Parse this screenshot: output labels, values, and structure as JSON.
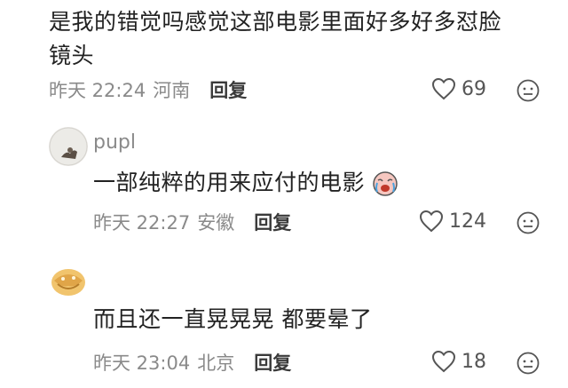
{
  "comments": [
    {
      "text_line1": "是我的错觉吗感觉这部电影里面好多好多怼脸",
      "text_line2": "镜头",
      "time": "昨天 22:24",
      "location": "河南",
      "reply_label": "回复",
      "likes": "69"
    },
    {
      "username": "pupl",
      "text": "一部纯粹的用来应付的电影",
      "sticker_icon": "crying-emoji-icon",
      "time": "昨天 22:27",
      "location": "安徽",
      "reply_label": "回复",
      "likes": "124"
    },
    {
      "username": "",
      "text": "而且还一直晃晃晃 都要晕了",
      "time": "昨天 23:04",
      "location": "北京",
      "reply_label": "回复",
      "likes": "18"
    }
  ],
  "icons": {
    "like": "heart-outline-icon",
    "emoji": "neutral-face-icon"
  }
}
